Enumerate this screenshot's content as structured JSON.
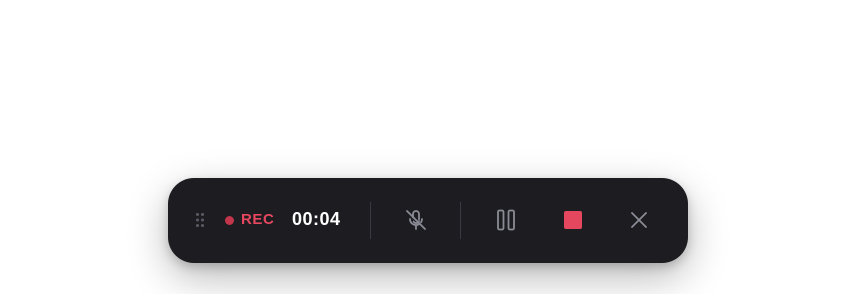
{
  "recorder": {
    "status_label": "REC",
    "elapsed_time": "00:04",
    "is_recording": true,
    "is_muted": true,
    "icons": {
      "drag": "drag-handle-icon",
      "mic": "microphone-off-icon",
      "pause": "pause-icon",
      "stop": "stop-icon",
      "close": "close-icon"
    },
    "colors": {
      "bar_background": "#1c1c21",
      "accent_red": "#e5475e",
      "rec_dot": "#c2354b",
      "text_primary": "#ffffff",
      "icon_muted": "#8b8b96",
      "divider": "#3a3a42"
    }
  }
}
